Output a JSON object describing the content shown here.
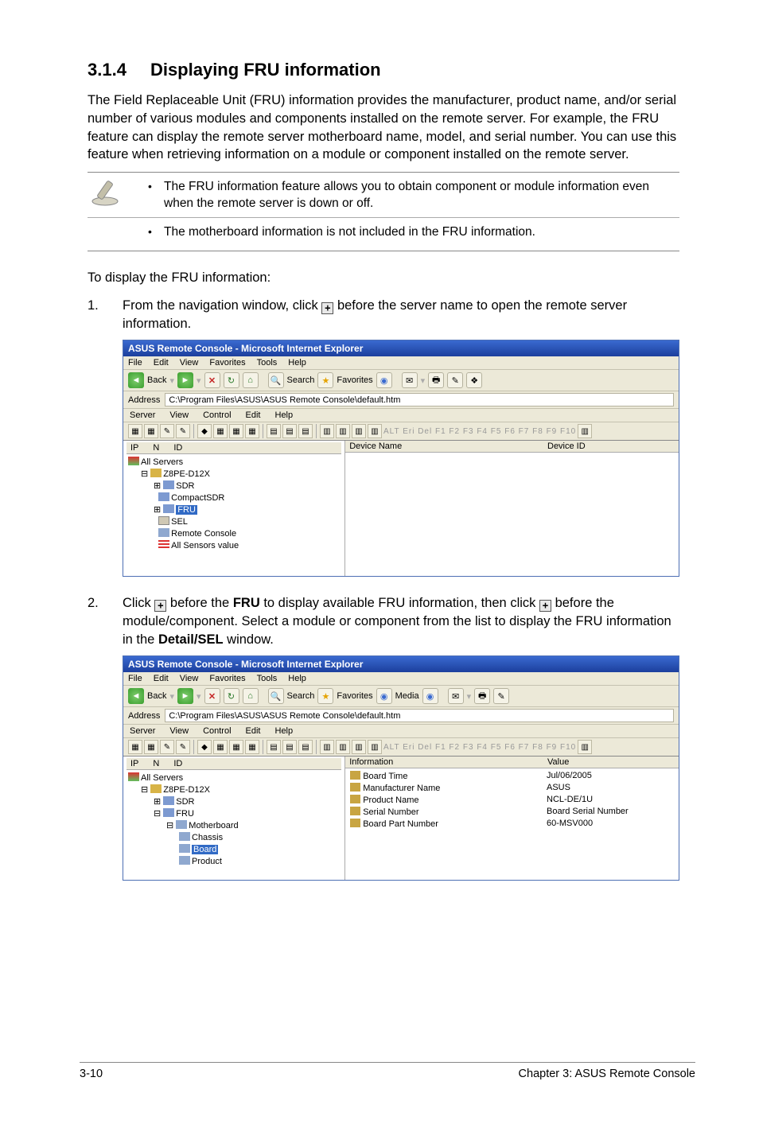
{
  "heading": {
    "number": "3.1.4",
    "title": "Displaying FRU information"
  },
  "intro": "The Field Replaceable Unit (FRU) information provides the manufacturer, product name, and/or serial number of various modules and components installed on the remote server. For example, the FRU feature can display the remote server motherboard name, model, and serial number. You can use this feature when retrieving information on a module or component installed on the remote server.",
  "notes": [
    "The FRU information feature allows you to obtain component or module information even when the remote server is down or off.",
    "The motherboard information is not included in the FRU information."
  ],
  "instructionsLead": "To display the FRU information:",
  "step1": {
    "num": "1.",
    "pre": "From the navigation window, click ",
    "post": " before the server name to open the remote server information."
  },
  "step2": {
    "num": "2.",
    "pre": "Click ",
    "mid1": " before the ",
    "boldFRU": "FRU",
    "mid2": " to display available FRU information, then click ",
    "mid3": " before the module/component. Select a module or component from the list to display the FRU information in the ",
    "boldDetail": "Detail/SEL",
    "post": " window."
  },
  "expandGlyph": "+",
  "ieWindow": {
    "title": "ASUS Remote Console - Microsoft Internet Explorer",
    "menus": [
      "File",
      "Edit",
      "View",
      "Favorites",
      "Tools",
      "Help"
    ],
    "backLabel": "Back",
    "searchLabel": "Search",
    "favoritesLabel": "Favorites",
    "mediaLabel": "Media",
    "addressLabel": "Address",
    "addressValue": "C:\\Program Files\\ASUS\\ASUS Remote Console\\default.htm",
    "appMenus": [
      "Server",
      "View",
      "Control",
      "Edit",
      "Help"
    ],
    "fkeys": "ALT Eri Del F1 F2 F3 F4 F5 F6 F7 F8 F9 F10",
    "leftCols": [
      "IP",
      "N",
      "ID"
    ],
    "rightCols": [
      "Device Name",
      "Device ID"
    ],
    "tree1": {
      "root": "All Servers",
      "server": "Z8PE-D12X",
      "nodes": [
        "SDR",
        "CompactSDR",
        "FRU",
        "SEL",
        "Remote Console",
        "All Sensors value"
      ]
    },
    "tree2": {
      "root": "All Servers",
      "server": "Z8PE-D12X",
      "sdr": "SDR",
      "fru": "FRU",
      "mb": "Motherboard",
      "mbChildren": [
        "Chassis",
        "Board",
        "Product"
      ]
    },
    "detailCols": [
      "Information",
      "Value"
    ],
    "detailRows": [
      {
        "k": "Board Time",
        "v": "Jul/06/2005"
      },
      {
        "k": "Manufacturer Name",
        "v": "ASUS"
      },
      {
        "k": "Product Name",
        "v": "NCL-DE/1U"
      },
      {
        "k": "Serial Number",
        "v": "Board Serial Number"
      },
      {
        "k": "Board Part Number",
        "v": "60-MSV000"
      }
    ]
  },
  "footer": {
    "left": "3-10",
    "right": "Chapter 3: ASUS Remote Console"
  }
}
